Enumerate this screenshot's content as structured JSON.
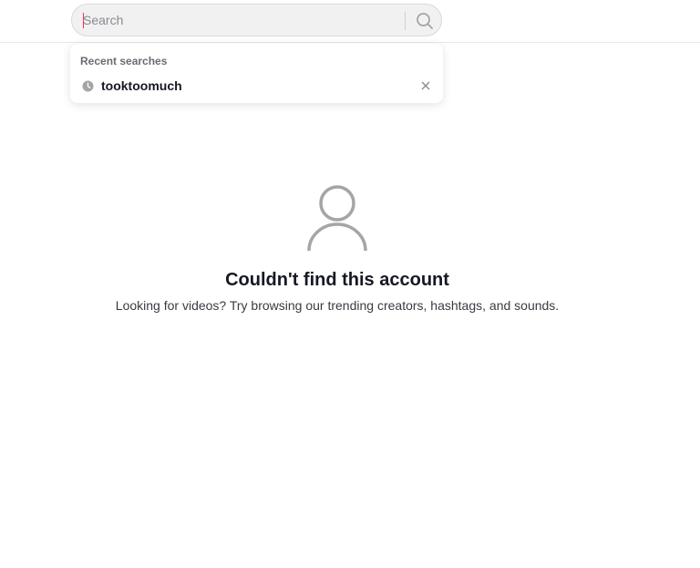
{
  "search": {
    "placeholder": "Search",
    "value": ""
  },
  "dropdown": {
    "title": "Recent searches",
    "items": [
      {
        "label": "tooktoomuch"
      }
    ]
  },
  "empty_state": {
    "icon": "user-icon",
    "title": "Couldn't find this account",
    "description": "Looking for videos? Try browsing our trending creators, hashtags, and sounds."
  },
  "colors": {
    "caret": "#fe2c55",
    "icon_gray": "#a5a5a8"
  }
}
